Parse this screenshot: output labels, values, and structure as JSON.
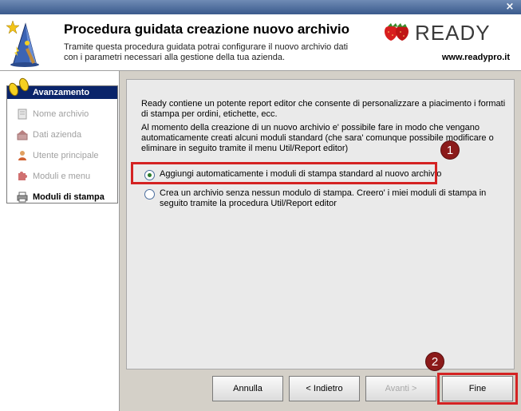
{
  "header": {
    "title": "Procedura guidata creazione nuovo archivio",
    "description": "Tramite questa procedura guidata potrai configurare il nuovo archivio dati con i parametri necessari alla gestione della tua azienda.",
    "brand": "READY",
    "website": "www.readypro.it"
  },
  "titlebar": {
    "close_label": "×"
  },
  "sidebar": {
    "progress_title": "Avanzamento",
    "steps": [
      {
        "label": "Nome archivio",
        "icon": "document-icon",
        "state": "done"
      },
      {
        "label": "Dati azienda",
        "icon": "company-icon",
        "state": "done"
      },
      {
        "label": "Utente principale",
        "icon": "user-icon",
        "state": "done"
      },
      {
        "label": "Moduli e menu",
        "icon": "puzzle-icon",
        "state": "done"
      },
      {
        "label": "Moduli di stampa",
        "icon": "printer-icon",
        "state": "active"
      }
    ]
  },
  "content": {
    "intro": "Ready contiene un potente report editor che consente di personalizzare a piacimento i formati di stampa per ordini, etichette, ecc.",
    "detail": "Al momento della creazione di un nuovo archivio e' possibile fare in modo che vengano automaticamente creati alcuni moduli standard (che sara' comunque possibile modificare o eliminare in seguito tramite il menu Util/Report editor)",
    "options": [
      {
        "label": "Aggiungi automaticamente i moduli di stampa standard al nuovo archivio",
        "checked": true
      },
      {
        "label": "Crea un archivio senza nessun modulo di stampa. Creero' i miei moduli di stampa in seguito tramite la procedura Util/Report editor",
        "checked": false
      }
    ]
  },
  "annotations": {
    "badge1": "1",
    "badge2": "2",
    "highlight_color": "#d42222"
  },
  "buttons": {
    "cancel": "Annulla",
    "back": "< Indietro",
    "next": "Avanti >",
    "finish": "Fine"
  }
}
